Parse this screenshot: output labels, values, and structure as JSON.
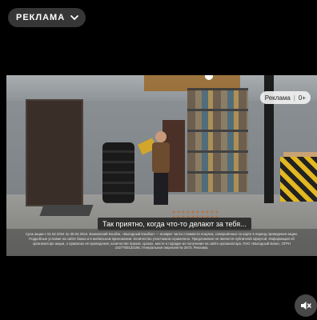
{
  "ad_label": "РЕКЛАМА",
  "badge": {
    "text": "Реклама",
    "age": "0+"
  },
  "subtitle": "Так приятно, когда что-то делают за тебя...",
  "disclaimer": "Срок акции с 01.02.2024 по 30.04.2024. Банковский Кэшбэк. «Выгодный Кэшбэк» — возврат части стоимости покупок, совершённых по карте в период проведения акции. Подробные условия на сайте банка и в мобильном приложении. Количество участников ограничено. Предложение не является публичной офертой. Информация об организаторе акции, о правилах её проведения, количестве призов, сроках, месте и порядке их получения на сайте организатора. ПАО «Выгодный Банк», ОГРН 1027700132195, Генеральная лицензия № 2673. Реклама.",
  "icons": {
    "dropdown": "chevron-down-icon",
    "sound": "speaker-muted-icon"
  }
}
